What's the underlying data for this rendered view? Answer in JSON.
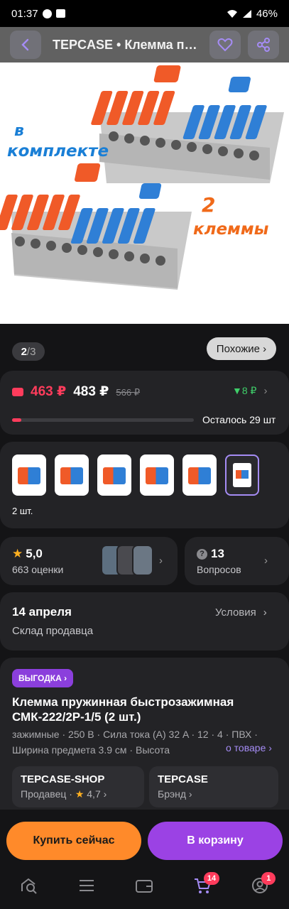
{
  "status_bar": {
    "time": "01:37",
    "battery": "46%"
  },
  "header": {
    "title": "TEPCASE • Клемма пружинная быстрозажимная"
  },
  "hero": {
    "line1": "в",
    "line2": "комплекте",
    "line3": "2",
    "line4": "клеммы"
  },
  "gallery": {
    "current": "2",
    "separator": "/",
    "total": "3",
    "similar_label": "Похожие ›"
  },
  "price": {
    "card_price": "463 ₽",
    "price": "483 ₽",
    "old_price": "566 ₽",
    "cashback": "▼8 ₽",
    "stock_text": "Осталось 29 шт",
    "stock_progress": 0.05
  },
  "variants": {
    "count": 6,
    "selected_index": 5,
    "selected_label": "2 шт."
  },
  "rating": {
    "value": "5,0",
    "count_text": "663 оценки"
  },
  "questions": {
    "value": "13",
    "label": "Вопросов"
  },
  "delivery": {
    "date": "14 апреля",
    "source": "Склад продавца",
    "conditions": "Условия"
  },
  "product": {
    "promo": "ВЫГОДКА ›",
    "title": "Клемма пружинная быстрозажимная СМК-222/2Р-1/5 (2 шт.)",
    "specs": "зажимные · 250 В · Сила тока (A) 32 A · 12 · 4 · ПВХ · Ширина предмета 3.9 см · Высота",
    "more_link": "о товаре ›"
  },
  "seller": {
    "name": "TEPCASE-SHOP",
    "role": "Продавец ·",
    "rating": "4,7 ›"
  },
  "brand": {
    "name": "TEPCASE",
    "role": "Брэнд ›"
  },
  "actions": {
    "buy_now": "Купить сейчас",
    "add_to_cart": "В корзину"
  },
  "nav": {
    "cart_badge": "14",
    "profile_badge": "1"
  },
  "colors": {
    "accent": "#9b42e4",
    "buy": "#ff8a2a",
    "price_red": "#ff3c5c",
    "cashback": "#3fcf6a"
  }
}
